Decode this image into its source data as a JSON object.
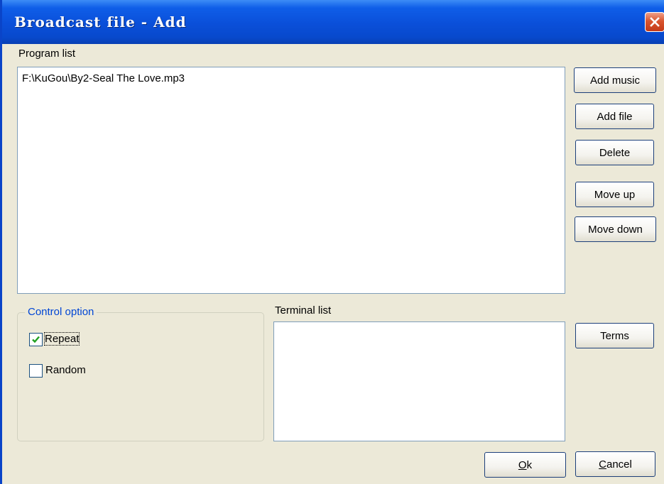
{
  "window": {
    "title": "Broadcast file - Add"
  },
  "program_list": {
    "label": "Program list",
    "items": [
      "F:\\KuGou\\By2-Seal The Love.mp3"
    ]
  },
  "buttons": {
    "add_music": "Add music",
    "add_file": "Add file",
    "delete": "Delete",
    "move_up": "Move up",
    "move_down": "Move down",
    "terms": "Terms",
    "ok_mnemonic": "O",
    "ok_rest": "k",
    "cancel_mnemonic": "C",
    "cancel_rest": "ancel"
  },
  "control_option": {
    "label": "Control option",
    "repeat": {
      "label": "Repeat",
      "checked": true
    },
    "random": {
      "label": "Random",
      "checked": false
    }
  },
  "terminal_list": {
    "label": "Terminal list",
    "items": []
  },
  "icons": {
    "close": "close-icon",
    "check": "checkmark-icon"
  },
  "colors": {
    "titlebar": "#0a4fd9",
    "dialog_bg": "#ece9d8",
    "group_legend": "#0046d5",
    "close_button": "#d9542e",
    "checkmark": "#21a121"
  }
}
